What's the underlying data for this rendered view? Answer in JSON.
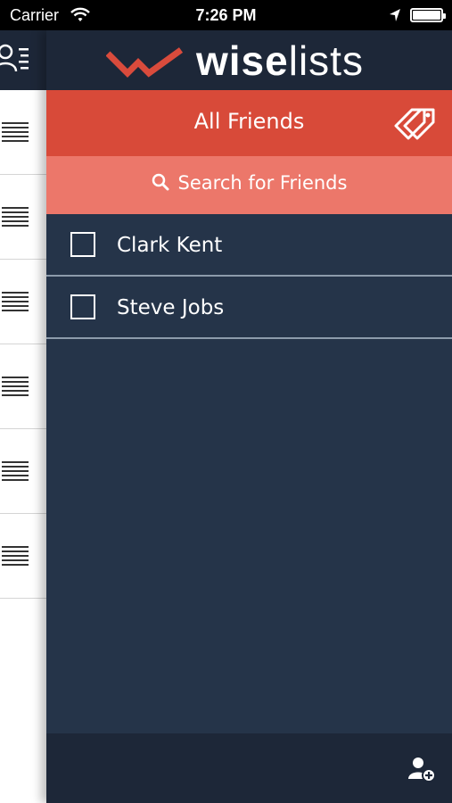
{
  "status_bar": {
    "carrier": "Carrier",
    "time": "7:26 PM",
    "battery_level": 1.0,
    "icons": [
      "wifi-icon",
      "location-arrow-icon",
      "battery-icon"
    ]
  },
  "app": {
    "logo_bold": "wise",
    "logo_light": "lists"
  },
  "title_bar": {
    "title": "All Friends",
    "tags_icon": "tags-icon"
  },
  "search": {
    "label": "Search for Friends",
    "icon": "search-icon"
  },
  "friends": [
    {
      "name": "Clark Kent",
      "checked": false
    },
    {
      "name": "Steve Jobs",
      "checked": false
    }
  ],
  "menu_strip": {
    "header_icon": "contacts-list-icon",
    "item_count": 6,
    "item_icon": "lines-icon"
  },
  "bottom_bar": {
    "action_icon": "add-friend-icon"
  },
  "colors": {
    "header_bg": "#1d2738",
    "main_bg": "#253449",
    "title_bar": "#d84a39",
    "search_bar": "#ec776a",
    "brand_red": "#d94b3c"
  }
}
